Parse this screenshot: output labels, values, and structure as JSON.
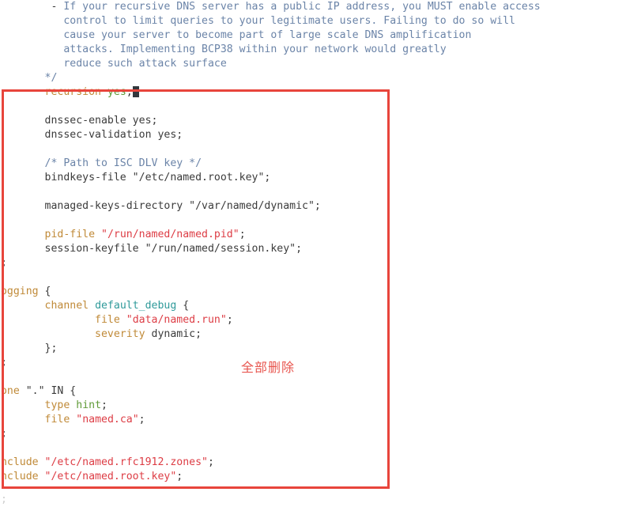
{
  "editor": {
    "kind": "text-editor-code-view",
    "file_syntax": "bind-named-conf",
    "background_color": "#ffffff",
    "font_color": "#3b3b3b"
  },
  "colors": {
    "comment": "#6b84a8",
    "keyword": "#c08a38",
    "string": "#dd3d45",
    "value": "#5f9a37",
    "identifier": "#2f9a9a",
    "plain": "#3b3b3b",
    "annotation_red": "#e8453c",
    "annotation_label_red": "#e8564f",
    "cursor": "#33383d"
  },
  "annotation": {
    "label": "全部删除",
    "box_present": "true"
  },
  "code": {
    "lines": [
      {
        "indent": "         - ",
        "tokens": [
          {
            "text": "If your recursive DNS server has a public IP address, you MUST enable access",
            "cls": "t-comment"
          }
        ]
      },
      {
        "indent": "           ",
        "tokens": [
          {
            "text": "control to limit queries to your legitimate users. Failing to do so will",
            "cls": "t-comment"
          }
        ]
      },
      {
        "indent": "           ",
        "tokens": [
          {
            "text": "cause your server to become part of large scale DNS amplification",
            "cls": "t-comment"
          }
        ]
      },
      {
        "indent": "           ",
        "tokens": [
          {
            "text": "attacks. Implementing BCP38 within your network would greatly",
            "cls": "t-comment"
          }
        ]
      },
      {
        "indent": "           ",
        "tokens": [
          {
            "text": "reduce such attack surface",
            "cls": "t-comment"
          }
        ]
      },
      {
        "indent": "        ",
        "tokens": [
          {
            "text": "*/",
            "cls": "t-comment"
          }
        ]
      },
      {
        "indent": "        ",
        "tokens": [
          {
            "text": "recursion",
            "cls": "t-keyword"
          },
          {
            "text": " ",
            "cls": "t-plain"
          },
          {
            "text": "yes",
            "cls": "t-value"
          },
          {
            "text": ";",
            "cls": "t-punct"
          },
          {
            "text": "",
            "cls": "cursor-here"
          }
        ]
      },
      {
        "indent": "",
        "tokens": []
      },
      {
        "indent": "        ",
        "tokens": [
          {
            "text": "dnssec-enable yes;",
            "cls": "t-plain"
          }
        ]
      },
      {
        "indent": "        ",
        "tokens": [
          {
            "text": "dnssec-validation yes;",
            "cls": "t-plain"
          }
        ]
      },
      {
        "indent": "",
        "tokens": []
      },
      {
        "indent": "        ",
        "tokens": [
          {
            "text": "/* Path to ISC DLV key */",
            "cls": "t-comment"
          }
        ]
      },
      {
        "indent": "        ",
        "tokens": [
          {
            "text": "bindkeys-file \"/etc/named.root.key\";",
            "cls": "t-plain"
          }
        ]
      },
      {
        "indent": "",
        "tokens": []
      },
      {
        "indent": "        ",
        "tokens": [
          {
            "text": "managed-keys-directory \"/var/named/dynamic\";",
            "cls": "t-plain"
          }
        ]
      },
      {
        "indent": "",
        "tokens": []
      },
      {
        "indent": "        ",
        "tokens": [
          {
            "text": "pid-file",
            "cls": "t-keyword"
          },
          {
            "text": " ",
            "cls": "t-plain"
          },
          {
            "text": "\"/run/named/named.pid\"",
            "cls": "t-string"
          },
          {
            "text": ";",
            "cls": "t-punct"
          }
        ]
      },
      {
        "indent": "        ",
        "tokens": [
          {
            "text": "session-keyfile \"/run/named/session.key\";",
            "cls": "t-plain"
          }
        ]
      },
      {
        "indent": "",
        "tokens": [
          {
            "text": "};",
            "cls": "t-plain"
          }
        ]
      },
      {
        "indent": "",
        "tokens": []
      },
      {
        "indent": "",
        "tokens": [
          {
            "text": "logging",
            "cls": "t-keyword"
          },
          {
            "text": " {",
            "cls": "t-plain"
          }
        ]
      },
      {
        "indent": "        ",
        "tokens": [
          {
            "text": "channel",
            "cls": "t-keyword"
          },
          {
            "text": " ",
            "cls": "t-plain"
          },
          {
            "text": "default_debug",
            "cls": "t-ident"
          },
          {
            "text": " {",
            "cls": "t-plain"
          }
        ]
      },
      {
        "indent": "                ",
        "tokens": [
          {
            "text": "file",
            "cls": "t-keyword"
          },
          {
            "text": " ",
            "cls": "t-plain"
          },
          {
            "text": "\"data/named.run\"",
            "cls": "t-string"
          },
          {
            "text": ";",
            "cls": "t-punct"
          }
        ]
      },
      {
        "indent": "                ",
        "tokens": [
          {
            "text": "severity",
            "cls": "t-keyword"
          },
          {
            "text": " dynamic;",
            "cls": "t-plain"
          }
        ]
      },
      {
        "indent": "        ",
        "tokens": [
          {
            "text": "};",
            "cls": "t-plain"
          }
        ]
      },
      {
        "indent": "",
        "tokens": [
          {
            "text": "};",
            "cls": "t-plain"
          }
        ]
      },
      {
        "indent": "",
        "tokens": []
      },
      {
        "indent": "",
        "tokens": [
          {
            "text": "zone",
            "cls": "t-keyword"
          },
          {
            "text": " \".\" IN {",
            "cls": "t-plain"
          }
        ]
      },
      {
        "indent": "        ",
        "tokens": [
          {
            "text": "type",
            "cls": "t-keyword"
          },
          {
            "text": " ",
            "cls": "t-plain"
          },
          {
            "text": "hint",
            "cls": "t-value"
          },
          {
            "text": ";",
            "cls": "t-punct"
          }
        ]
      },
      {
        "indent": "        ",
        "tokens": [
          {
            "text": "file",
            "cls": "t-keyword"
          },
          {
            "text": " ",
            "cls": "t-plain"
          },
          {
            "text": "\"named.ca\"",
            "cls": "t-string"
          },
          {
            "text": ";",
            "cls": "t-punct"
          }
        ]
      },
      {
        "indent": "",
        "tokens": [
          {
            "text": "};",
            "cls": "t-plain"
          }
        ]
      },
      {
        "indent": "",
        "tokens": []
      },
      {
        "indent": "",
        "tokens": [
          {
            "text": "include",
            "cls": "t-keyword"
          },
          {
            "text": " ",
            "cls": "t-plain"
          },
          {
            "text": "\"/etc/named.rfc1912.zones\"",
            "cls": "t-string"
          },
          {
            "text": ";",
            "cls": "t-punct"
          }
        ]
      },
      {
        "indent": "",
        "tokens": [
          {
            "text": "include",
            "cls": "t-keyword"
          },
          {
            "text": " ",
            "cls": "t-plain"
          },
          {
            "text": "\"/etc/named.root.key\"",
            "cls": "t-string"
          },
          {
            "text": ";",
            "cls": "t-punct"
          }
        ]
      }
    ],
    "below_clipped_glyph": "};"
  }
}
